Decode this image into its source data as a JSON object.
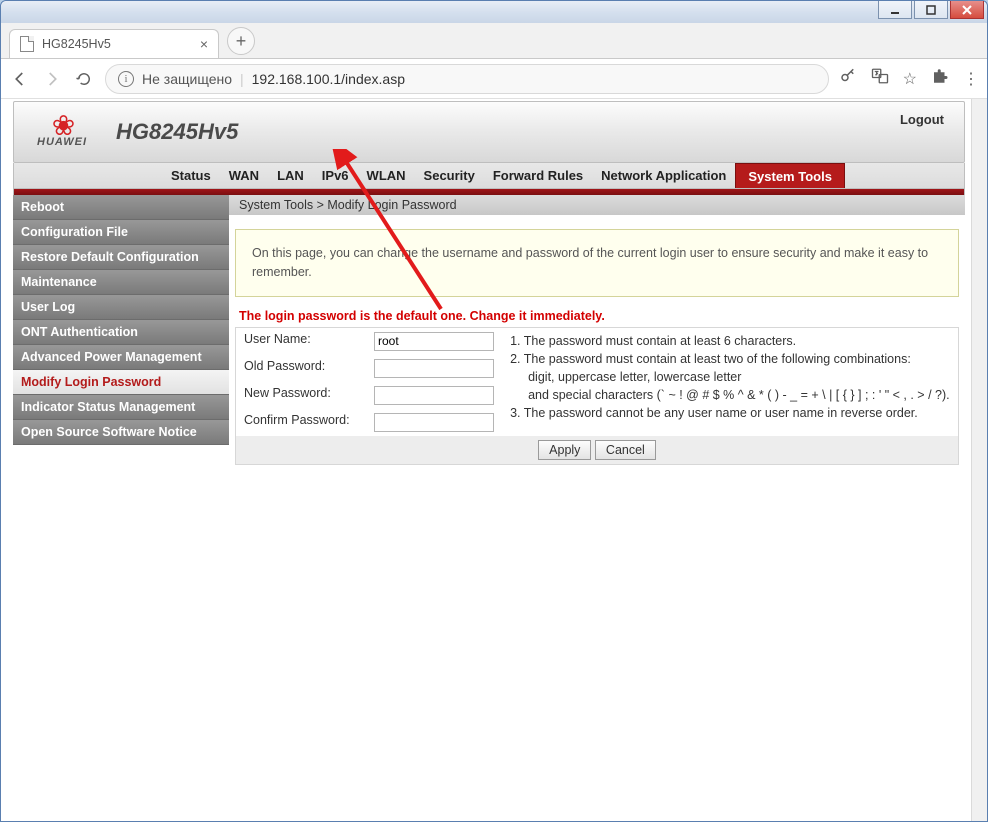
{
  "browser": {
    "tab_title": "HG8245Hv5",
    "address_insecure": "Не защищено",
    "address_url": "192.168.100.1/index.asp"
  },
  "header": {
    "brand": "HUAWEI",
    "model": "HG8245Hv5",
    "logout": "Logout"
  },
  "nav": {
    "items": [
      "Status",
      "WAN",
      "LAN",
      "IPv6",
      "WLAN",
      "Security",
      "Forward Rules",
      "Network Application",
      "System Tools"
    ],
    "active_index": 8
  },
  "sidebar": {
    "items": [
      "Reboot",
      "Configuration File",
      "Restore Default Configuration",
      "Maintenance",
      "User Log",
      "ONT Authentication",
      "Advanced Power Management",
      "Modify Login Password",
      "Indicator Status Management",
      "Open Source Software Notice"
    ],
    "active_index": 7
  },
  "breadcrumb": "System Tools > Modify Login Password",
  "infobox": "On this page, you can change the username and password of the current login user to ensure security and make it easy to remember.",
  "warning": "The login password is the default one. Change it immediately.",
  "form": {
    "labels": {
      "username": "User Name:",
      "old_pw": "Old Password:",
      "new_pw": "New Password:",
      "confirm_pw": "Confirm Password:"
    },
    "values": {
      "username": "root",
      "old_pw": "",
      "new_pw": "",
      "confirm_pw": ""
    },
    "rules": {
      "r1": "1. The password must contain at least 6 characters.",
      "r2": "2. The password must contain at least two of the following combinations:",
      "r2a": "digit, uppercase letter, lowercase letter",
      "r2b": "and special characters (` ~ ! @ # $ % ^ & * ( ) - _ = + \\ | [ { } ] ; : ' \" < , . > / ?).",
      "r3": "3. The password cannot be any user name or user name in reverse order."
    },
    "buttons": {
      "apply": "Apply",
      "cancel": "Cancel"
    }
  }
}
